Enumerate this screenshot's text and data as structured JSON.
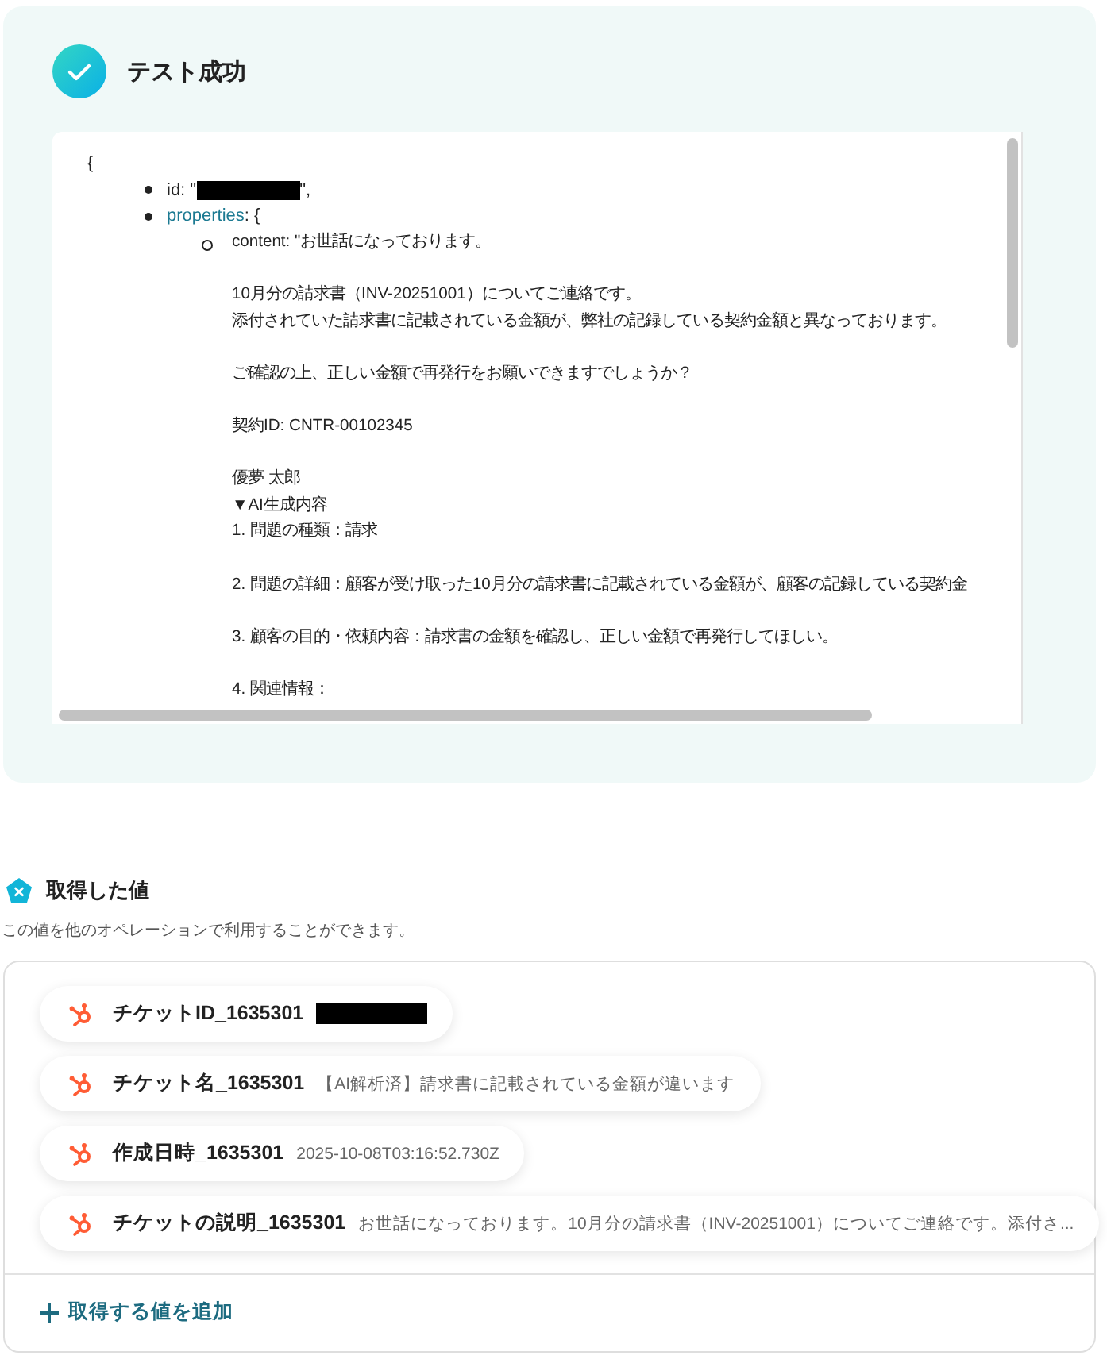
{
  "test_result": {
    "title": "テスト成功",
    "output": {
      "open": "{",
      "id_prefix": "id: \"",
      "id_redacted": true,
      "id_suffix": "\",",
      "properties_key": "properties",
      "properties_rest": ": {",
      "lines": [
        {
          "kind": "text",
          "text": "content: \"お世話になっております。"
        },
        {
          "kind": "blank"
        },
        {
          "kind": "text",
          "text": "10月分の請求書（INV-20251001）についてご連絡です。"
        },
        {
          "kind": "text",
          "text": "添付されていた請求書に記載されている金額が、弊社の記録している契約金額と異なっております。"
        },
        {
          "kind": "blank"
        },
        {
          "kind": "text",
          "text": "ご確認の上、正しい金額で再発行をお願いできますでしょうか？"
        },
        {
          "kind": "blank"
        },
        {
          "kind": "text",
          "text": "契約ID: CNTR-00102345"
        },
        {
          "kind": "blank"
        },
        {
          "kind": "text",
          "text": "優夢 太郎"
        },
        {
          "kind": "text",
          "text": "▼AI生成内容"
        },
        {
          "kind": "text",
          "text": "1. 問題の種類：請求"
        },
        {
          "kind": "blank"
        },
        {
          "kind": "text",
          "text": "2. 問題の詳細：顧客が受け取った10月分の請求書に記載されている金額が、顧客の記録している契約金"
        },
        {
          "kind": "blank"
        },
        {
          "kind": "text",
          "text": "3. 顧客の目的・依頼内容：請求書の金額を確認し、正しい金額で再発行してほしい。"
        },
        {
          "kind": "blank"
        },
        {
          "kind": "text",
          "text": "4. 関連情報："
        }
      ]
    }
  },
  "retrieved_values": {
    "title": "取得した値",
    "description": "この値を他のオペレーションで利用することができます。",
    "items": [
      {
        "label": "チケットID_1635301",
        "redacted": true
      },
      {
        "label": "チケット名_1635301",
        "value": "【AI解析済】請求書に記載されている金額が違います",
        "redacted": false
      },
      {
        "label": "作成日時_1635301",
        "value": "2025-10-08T03:16:52.730Z",
        "redacted": false
      },
      {
        "label": "チケットの説明_1635301",
        "value": "お世話になっております。10月分の請求書（INV-20251001）についてご連絡です。添付さ...",
        "redacted": false
      }
    ],
    "add_button": "取得する値を追加"
  }
}
